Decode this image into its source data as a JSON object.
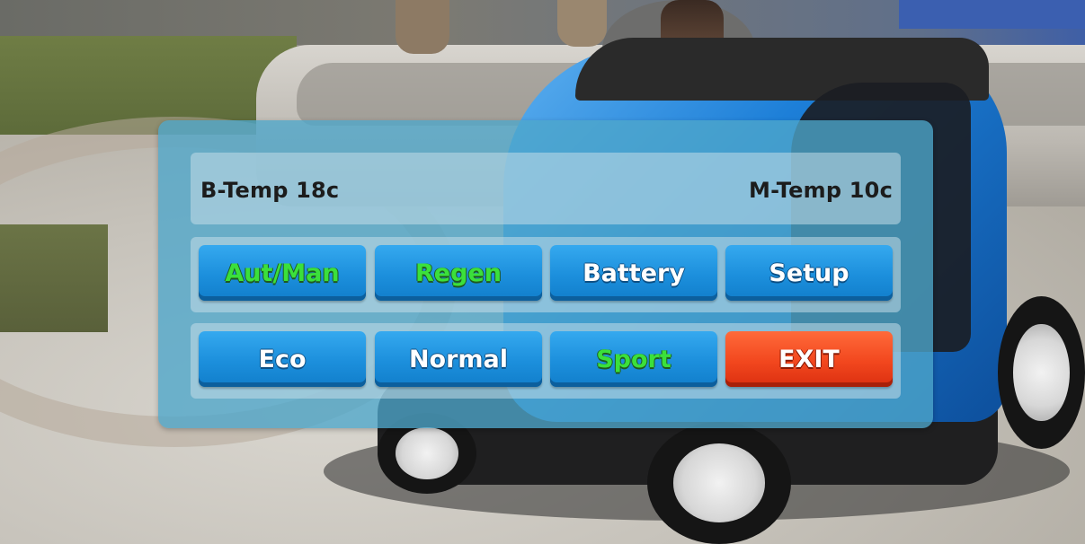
{
  "temps": {
    "battery": "B-Temp 18c",
    "motor": "M-Temp 10c"
  },
  "row1": [
    {
      "label": "Aut/Man",
      "color": "#3be03b",
      "style": "green"
    },
    {
      "label": "Regen",
      "color": "#3be03b",
      "style": "green"
    },
    {
      "label": "Battery",
      "color": "#ffffff",
      "style": "default"
    },
    {
      "label": "Setup",
      "color": "#ffffff",
      "style": "default"
    }
  ],
  "row2": [
    {
      "label": "Eco",
      "color": "#ffffff",
      "style": "default"
    },
    {
      "label": "Normal",
      "color": "#ffffff",
      "style": "default"
    },
    {
      "label": "Sport",
      "color": "#3be03b",
      "style": "green"
    },
    {
      "label": "EXIT",
      "color": "#ffffff",
      "style": "exit"
    }
  ],
  "colors": {
    "panel": "#4ea6cb",
    "button_blue": "#1c8fdc",
    "button_exit": "#f2471e",
    "active_text": "#3be03b"
  }
}
